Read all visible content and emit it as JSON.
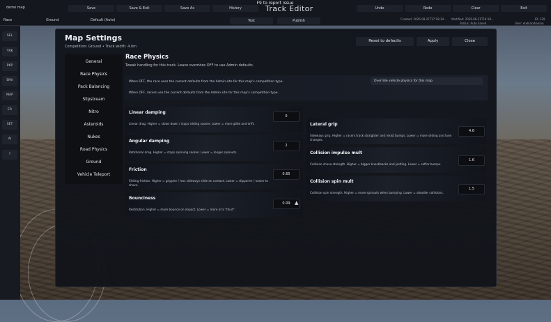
{
  "topbar": {
    "map_name": "demo map",
    "save": "Save",
    "save_exit": "Save & Exit",
    "save_as": "Save As",
    "history": "History",
    "hint": "F9 to report issue",
    "title": "Track Editor",
    "undo": "Undo",
    "redo": "Redo",
    "clear": "Clear",
    "exit": "Exit",
    "type": "Race",
    "surface": "Ground",
    "mode": "Default (Auto)",
    "test": "Test",
    "publish": "Publish",
    "created": "Created: 2026-08-21T17:18:34...",
    "modified": "Modified: 2026-08-21T18:18...",
    "status": "Status: Auto Saved",
    "id": "ID: 339",
    "user": "User: elxbrandianian"
  },
  "rail": [
    "SEL",
    "TRK",
    "PKP",
    "ENV",
    "MAP",
    "ER",
    "SET",
    "AI",
    "?"
  ],
  "dialog": {
    "title": "Map Settings",
    "subtitle": "Competition: Ground  •  Track width: 4.0m",
    "reset": "Reset to defaults",
    "apply": "Apply",
    "close": "Close"
  },
  "nav": [
    "General",
    "Race Physics",
    "Pack Balancing",
    "Slipstream",
    "Nitro",
    "Asteroids",
    "Nukes",
    "Road Physics",
    "Ground",
    "Vehicle Teleport"
  ],
  "section": {
    "title": "Race Physics",
    "desc": "Tweak handling for this track. Leave overrides OFF to use Admin defaults.",
    "notice_on": "When OFF, the race uses the current defaults from the Admin site for this map's competition type.",
    "notice_off": "When OFF, racers use the current defaults from the Admin site for this map's competition type.",
    "override": "Override vehicle physics for this map"
  },
  "left_params": [
    {
      "name": "Linear damping",
      "desc": "Linear drag. Higher = slows down / stops sliding sooner. Lower = more glide and drift.",
      "value": "0"
    },
    {
      "name": "Angular damping",
      "desc": "Rotational drag. Higher = stops spinning sooner. Lower = longer spinouts.",
      "value": "2"
    },
    {
      "name": "Friction",
      "desc": "Sliding friction. Higher = grippier / less sideways slide on contact. Lower = slipperier / easier to shove.",
      "value": "0.65"
    },
    {
      "name": "Bounciness",
      "desc": "Restitution. Higher = more bounce on impact. Lower = more of a \"thud\".",
      "value": "0.09"
    }
  ],
  "right_params": [
    {
      "name": "Lateral grip",
      "desc": "Sideways grip. Higher = racers track straighter and resist bumps. Lower = more sliding and lane changes.",
      "value": "4.6"
    },
    {
      "name": "Collision impulse mult",
      "desc": "Collision shove strength. Higher = bigger knockbacks and jostling. Lower = softer bumps.",
      "value": "1.6"
    },
    {
      "name": "Collision spin mult",
      "desc": "Collision spin strength. Higher = more spinouts when bumping. Lower = steadier collisions.",
      "value": "1.5"
    }
  ]
}
